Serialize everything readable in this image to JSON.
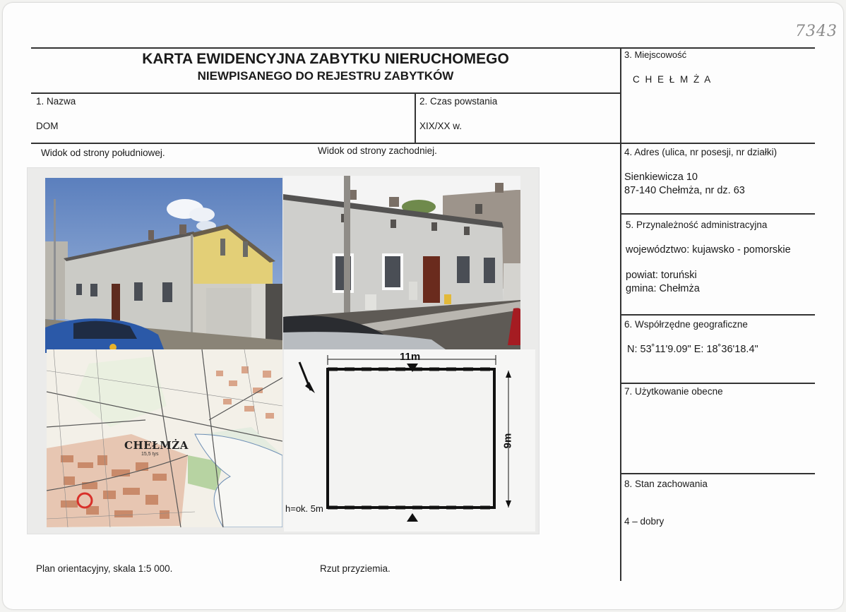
{
  "form": {
    "title_line1": "KARTA EWIDENCYJNA ZABYTKU NIERUCHOMEGO",
    "title_line2": "NIEWPISANEGO DO REJESTRU ZABYTKÓW",
    "ref_number": "7343"
  },
  "fields": {
    "nazwa_label": "1. Nazwa",
    "nazwa_value": "DOM",
    "czas_label": "2. Czas powstania",
    "czas_value": "XIX/XX w.",
    "miejscowosc_label": "3. Miejscowość",
    "miejscowosc_value": "C H E Ł M Ż A",
    "adres_label": "4. Adres (ulica, nr posesji, nr działki)",
    "adres_line1": "Sienkiewicza 10",
    "adres_line2": "87-140 Chełmża, nr dz. 63",
    "przynaleznosc_label": "5. Przynależność administracyjna",
    "wojewodztwo": "województwo: kujawsko - pomorskie",
    "powiat": "powiat: toruński",
    "gmina": "gmina: Chełmża",
    "wspolrzedne_label": "6. Współrzędne geograficzne",
    "wspolrzedne_value": "N: 53˚11'9.09\"   E: 18˚36'18.4\"",
    "uzytkowanie_label": "7. Użytkowanie obecne",
    "stan_label": "8. Stan zachowania",
    "stan_value": "4 – dobry"
  },
  "captions": {
    "widok_poludniowy": "Widok od strony południowej.",
    "widok_zachodni": "Widok od strony zachodniej.",
    "plan": "Plan orientacyjny, skala 1:5 000.",
    "rzut": "Rzut przyziemia."
  },
  "map": {
    "town_label": "CHEŁMŻA",
    "sub_label": "15,5 tys"
  },
  "plan_drawing": {
    "width_label": "11m",
    "depth_label": "9m",
    "height_label": "h=ok. 5m"
  },
  "colors": {
    "sky": "#6f8fc4",
    "facade_gray": "#cfcfcb",
    "facade_yellow": "#e6d27a",
    "map_pink": "#d9a58a",
    "map_green": "#b7d3a2",
    "marker_red": "#d8312a"
  }
}
